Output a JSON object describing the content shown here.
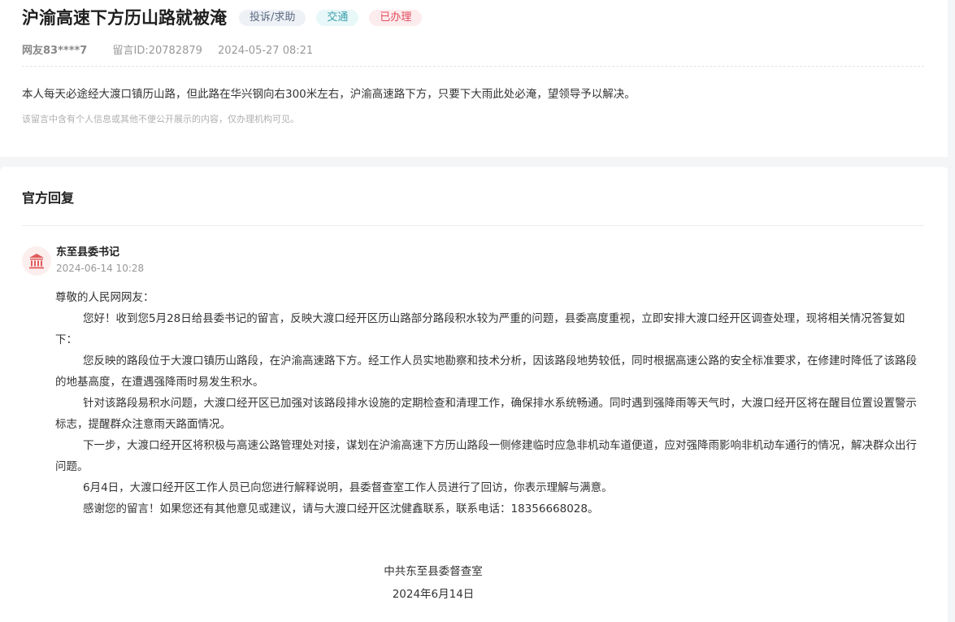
{
  "message": {
    "title": "沪渝高速下方历山路就被淹",
    "tags": [
      "投诉/求助",
      "交通",
      "已办理"
    ],
    "user": "网友83****7",
    "message_id": "留言ID:20782879",
    "datetime": "2024-05-27 08:21",
    "content": "本人每天必途经大渡口镇历山路，但此路在华兴钢向右300米左右，沪渝高速路下方，只要下大雨此处必淹，望领导予以解决。",
    "notice": "该留言中含有个人信息或其他不便公开展示的内容，仅办理机构可见。"
  },
  "reply": {
    "section_title": "官方回复",
    "avatar_icon": "government-building-icon",
    "org": "东至县委书记",
    "date": "2024-06-14 10:28",
    "greeting": "尊敬的人民网网友：",
    "paragraphs": [
      "您好！收到您5月28日给县委书记的留言，反映大渡口经开区历山路部分路段积水较为严重的问题，县委高度重视，立即安排大渡口经开区调查处理，现将相关情况答复如下：",
      "您反映的路段位于大渡口镇历山路段，在沪渝高速路下方。经工作人员实地勘察和技术分析，因该路段地势较低，同时根据高速公路的安全标准要求，在修建时降低了该路段的地基高度，在遭遇强降雨时易发生积水。",
      "针对该路段易积水问题，大渡口经开区已加强对该路段排水设施的定期检查和清理工作，确保排水系统畅通。同时遇到强降雨等天气时，大渡口经开区将在醒目位置设置警示标志，提醒群众注意雨天路面情况。",
      "下一步，大渡口经开区将积极与高速公路管理处对接，谋划在沪渝高速下方历山路段一侧修建临时应急非机动车道便道，应对强降雨影响非机动车通行的情况，解决群众出行问题。",
      "6月4日，大渡口经开区工作人员已向您进行解释说明，县委督查室工作人员进行了回访，你表示理解与满意。",
      "感谢您的留言！如果您还有其他意见或建议，请与大渡口经开区沈健鑫联系，联系电话：18356668028。"
    ],
    "signature": "中共东至县委督查室",
    "sign_date": "2024年6月14日"
  },
  "colors": {
    "tag_category": "#5b6a80",
    "tag_domain": "#3aa0ad",
    "tag_status": "#e24b5a",
    "avatar_icon": "#e05a5a"
  }
}
